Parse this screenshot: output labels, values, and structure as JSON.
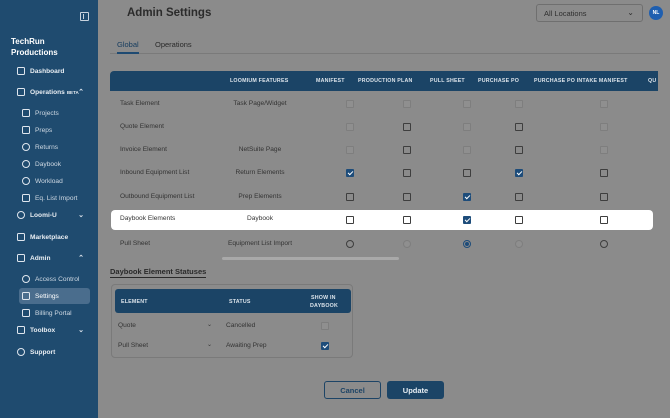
{
  "sidebar": {
    "org_name": "TechRun Productions",
    "items": [
      {
        "label": "Dashboard"
      },
      {
        "label": "Operations",
        "badge": "BETA"
      },
      {
        "label": "Projects"
      },
      {
        "label": "Preps"
      },
      {
        "label": "Returns"
      },
      {
        "label": "Daybook"
      },
      {
        "label": "Workload"
      },
      {
        "label": "Eq. List Import"
      },
      {
        "label": "Loomi-U"
      },
      {
        "label": "Marketplace"
      },
      {
        "label": "Admin"
      },
      {
        "label": "Access Control"
      },
      {
        "label": "Settings"
      },
      {
        "label": "Billing Portal"
      },
      {
        "label": "Toolbox"
      },
      {
        "label": "Support"
      }
    ]
  },
  "header": {
    "title": "Admin Settings",
    "location": "All Locations",
    "avatar_initials": "NL"
  },
  "tabs": [
    {
      "label": "Global"
    },
    {
      "label": "Operations"
    }
  ],
  "features_table": {
    "headers": [
      "LOOMIUM FEATURES",
      "MANIFEST",
      "PRODUCTION PLAN",
      "PULL SHEET",
      "PURCHASE PO",
      "PURCHASE PO INTAKE MANIFEST",
      "QU"
    ],
    "rows": [
      {
        "name": "Task Element",
        "feature": "Task Page/Widget",
        "states": [
          "dis",
          "dis",
          "dis",
          "dis",
          "dis"
        ]
      },
      {
        "name": "Quote Element",
        "feature": "",
        "states": [
          "dis",
          "off",
          "dis",
          "off",
          "dis"
        ]
      },
      {
        "name": "Invoice Element",
        "feature": "NetSuite Page",
        "states": [
          "dis",
          "off",
          "dis",
          "off",
          "dis"
        ]
      },
      {
        "name": "Inbound Equipment List",
        "feature": "Return Elements",
        "states": [
          "on",
          "off",
          "off",
          "on",
          "off"
        ]
      },
      {
        "name": "Outbound Equipment List",
        "feature": "Prep Elements",
        "states": [
          "off",
          "off",
          "on",
          "off",
          "off"
        ]
      },
      {
        "name": "Daybook Elements",
        "feature": "Daybook",
        "states": [
          "off",
          "off",
          "on",
          "off",
          "off"
        ]
      },
      {
        "name": "Pull Sheet",
        "feature": "Equipment List Import",
        "states": [
          "r-off",
          "r-dis",
          "r-on",
          "r-dis",
          "r-off"
        ]
      }
    ]
  },
  "statuses": {
    "title": "Daybook Element Statuses",
    "headers": [
      "ELEMENT",
      "STATUS",
      "SHOW IN",
      "DAYBOOK"
    ],
    "rows": [
      {
        "element": "Quote",
        "status": "Cancelled",
        "show": false
      },
      {
        "element": "Pull Sheet",
        "status": "Awaiting Prep",
        "show": true
      }
    ]
  },
  "buttons": {
    "cancel": "Cancel",
    "update": "Update"
  }
}
